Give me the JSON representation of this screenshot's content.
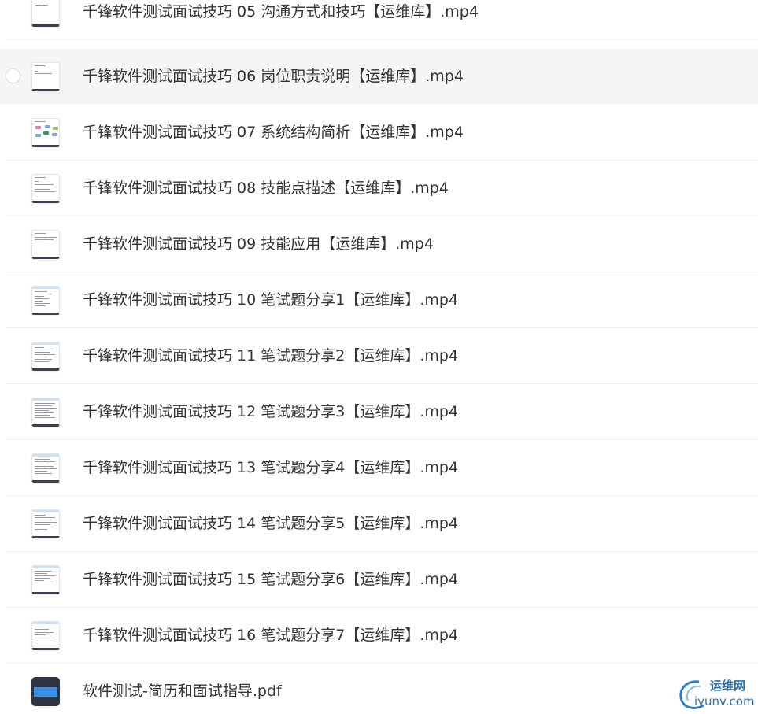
{
  "files": [
    {
      "name": "千锋软件测试面试技巧 05 沟通方式和技巧【运维库】.mp4",
      "thumb_icon": "video-thumbnail-icon"
    },
    {
      "name": "千锋软件测试面试技巧 06 岗位职责说明【运维库】.mp4",
      "thumb_icon": "video-thumbnail-icon"
    },
    {
      "name": "千锋软件测试面试技巧 07 系统结构简析【运维库】.mp4",
      "thumb_icon": "video-thumbnail-icon"
    },
    {
      "name": "千锋软件测试面试技巧 08 技能点描述【运维库】.mp4",
      "thumb_icon": "video-thumbnail-icon"
    },
    {
      "name": "千锋软件测试面试技巧 09 技能应用【运维库】.mp4",
      "thumb_icon": "video-thumbnail-icon"
    },
    {
      "name": "千锋软件测试面试技巧 10 笔试题分享1【运维库】.mp4",
      "thumb_icon": "video-thumbnail-icon"
    },
    {
      "name": "千锋软件测试面试技巧 11 笔试题分享2【运维库】.mp4",
      "thumb_icon": "video-thumbnail-icon"
    },
    {
      "name": "千锋软件测试面试技巧 12 笔试题分享3【运维库】.mp4",
      "thumb_icon": "video-thumbnail-icon"
    },
    {
      "name": "千锋软件测试面试技巧 13 笔试题分享4【运维库】.mp4",
      "thumb_icon": "video-thumbnail-icon"
    },
    {
      "name": "千锋软件测试面试技巧 14 笔试题分享5【运维库】.mp4",
      "thumb_icon": "video-thumbnail-icon"
    },
    {
      "name": "千锋软件测试面试技巧 15 笔试题分享6【运维库】.mp4",
      "thumb_icon": "video-thumbnail-icon"
    },
    {
      "name": "千锋软件测试面试技巧 16 笔试题分享7【运维库】.mp4",
      "thumb_icon": "video-thumbnail-icon"
    },
    {
      "name": "软件测试-简历和面试指导.pdf",
      "thumb_icon": "pdf-thumbnail-icon"
    }
  ],
  "hovered_index": 1,
  "watermark": {
    "cn": "运维网",
    "en": "iyunv.com",
    "color": "#2f6fa8"
  },
  "colors": {
    "text": "#333333",
    "hover_bg": "#f5f5f5",
    "separator": "#eeeeee",
    "pdf_accent": "#3b8fe0"
  }
}
